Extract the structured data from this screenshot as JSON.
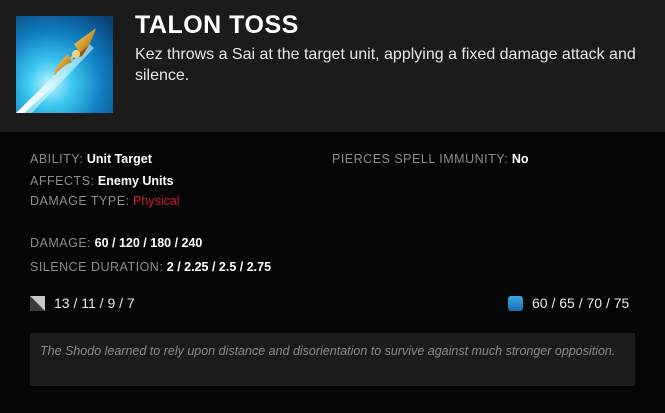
{
  "ability": {
    "name": "TALON TOSS",
    "description": "Kez throws a Sai at the target unit, applying a fixed damage attack and silence.",
    "icon": "sai-dagger-icon"
  },
  "stats": {
    "ability": {
      "label": "ABILITY:",
      "value": "Unit Target"
    },
    "affects": {
      "label": "AFFECTS:",
      "value": "Enemy Units"
    },
    "damage_type": {
      "label": "DAMAGE TYPE:",
      "value": "Physical"
    },
    "pierces": {
      "label": "PIERCES SPELL IMMUNITY:",
      "value": "No"
    },
    "damage": {
      "label": "DAMAGE:",
      "value": "60 / 120 / 180 / 240"
    },
    "silence_duration": {
      "label": "SILENCE DURATION:",
      "value": "2 / 2.25 / 2.5 / 2.75"
    }
  },
  "costs": {
    "cooldown": {
      "icon": "cooldown-icon",
      "value": "13 / 11 / 9 / 7"
    },
    "mana": {
      "icon": "mana-icon",
      "value": "60 / 65 / 70 / 75"
    }
  },
  "lore": "The Shodo learned to rely upon distance and disorientation to survive against much stronger opposition.",
  "colors": {
    "header_bg": "#1b1b1b",
    "body_bg": "#050505",
    "label": "#8c8c8c",
    "value": "#ffffff",
    "physical": "#d21f1f",
    "mana": "#2a8fd6",
    "lore_text": "#8a8a8a"
  }
}
